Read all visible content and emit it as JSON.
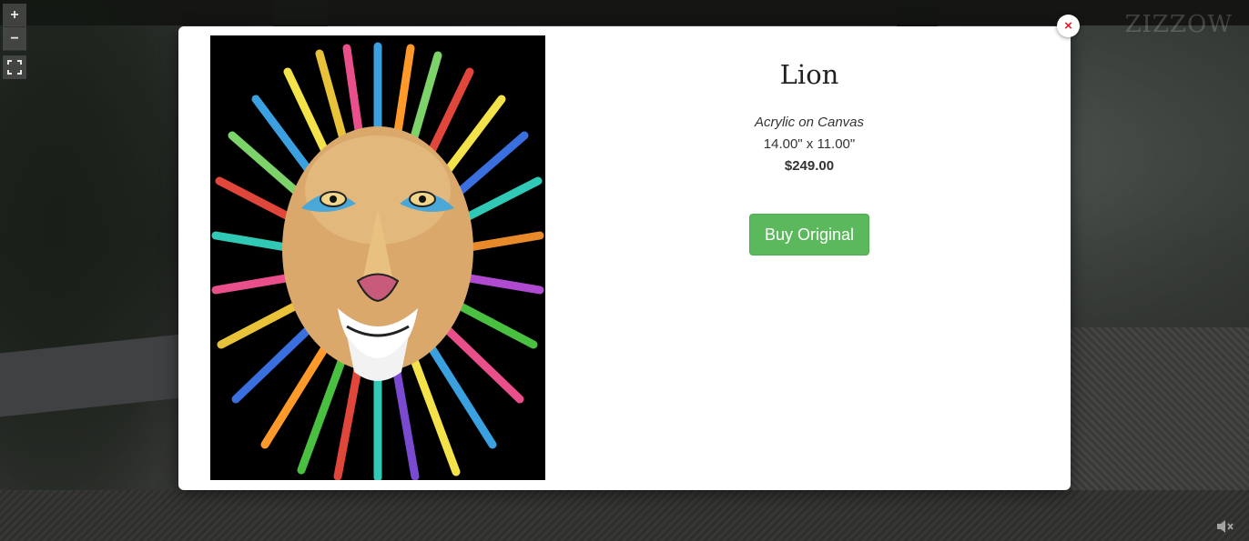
{
  "viewer": {
    "zoom_in_label": "+",
    "zoom_out_label": "−",
    "fullscreen_icon": "fullscreen-icon",
    "watermark": "ZIZZOW",
    "mute_icon": "mute-icon"
  },
  "modal": {
    "close_label": "×",
    "artwork": {
      "title": "Lion",
      "medium": "Acrylic on Canvas",
      "size": "14.00\" x 11.00\"",
      "price": "$249.00",
      "buy_label": "Buy Original"
    }
  },
  "colors": {
    "buy_button": "#5cb85c",
    "close_icon": "#e0202a"
  }
}
